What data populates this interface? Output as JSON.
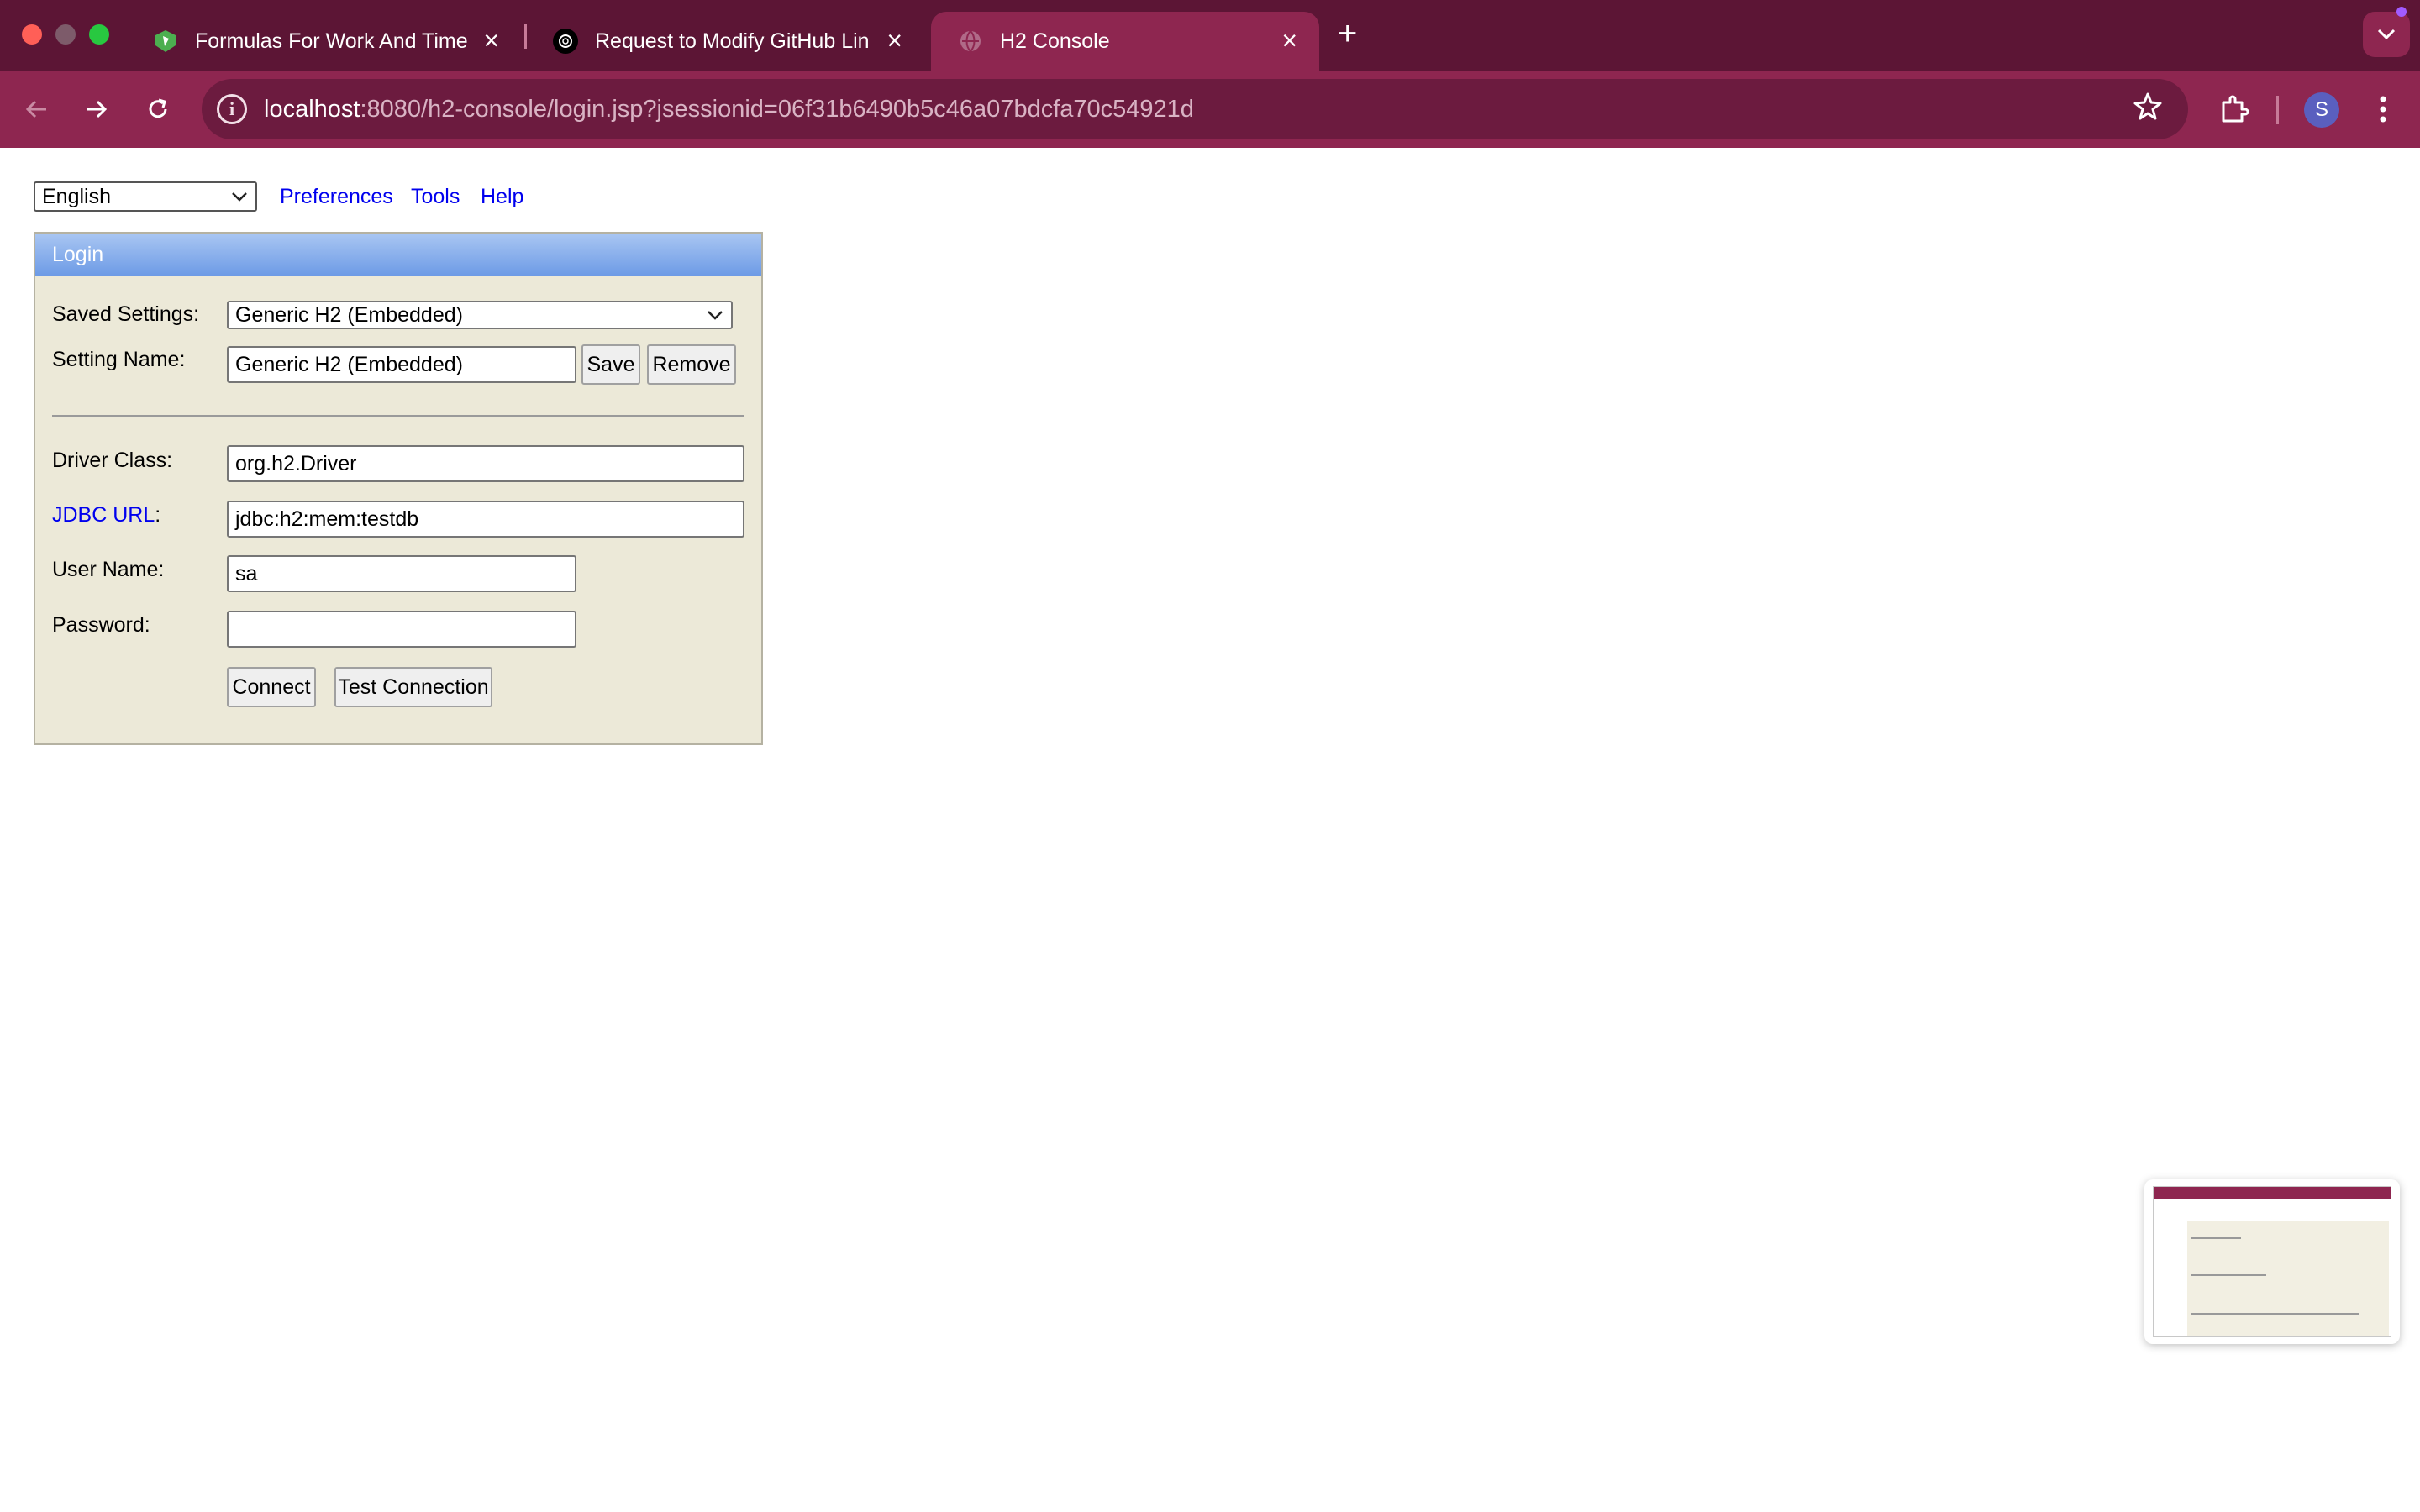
{
  "browser": {
    "tabs": [
      {
        "title": "Formulas For Work And Time",
        "icon": "shield-leaf-icon",
        "active": false
      },
      {
        "title": "Request to Modify GitHub Lin",
        "icon": "openai-icon",
        "active": false
      },
      {
        "title": "H2 Console",
        "icon": "globe-icon",
        "active": true
      }
    ],
    "new_tab": "+",
    "url_host": "localhost",
    "url_rest": ":8080/h2-console/login.jsp?jsessionid=06f31b6490b5c46a07bdcfa70c54921d",
    "profile_initial": "S",
    "colors": {
      "frame": "#5c1535",
      "toolbar": "#8e2650",
      "omnibox": "#6c1b3f"
    }
  },
  "topbar": {
    "language": "English",
    "links": [
      "Preferences",
      "Tools",
      "Help"
    ]
  },
  "login": {
    "header": "Login",
    "saved_settings_label": "Saved Settings:",
    "saved_settings_value": "Generic H2 (Embedded)",
    "setting_name_label": "Setting Name:",
    "setting_name_value": "Generic H2 (Embedded)",
    "save_label": "Save",
    "remove_label": "Remove",
    "driver_class_label": "Driver Class:",
    "driver_class_value": "org.h2.Driver",
    "jdbc_url_label": "JDBC URL",
    "jdbc_url_colon": ":",
    "jdbc_url_value": "jdbc:h2:mem:testdb",
    "user_name_label": "User Name:",
    "user_name_value": "sa",
    "password_label": "Password:",
    "password_value": "",
    "connect_label": "Connect",
    "test_connection_label": "Test Connection"
  }
}
